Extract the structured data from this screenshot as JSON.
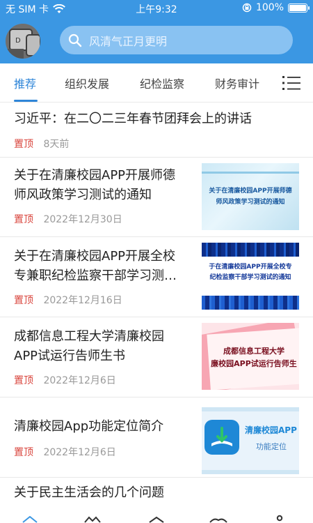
{
  "status": {
    "carrier": "无 SIM 卡",
    "time": "上午9:32",
    "battery": "100%"
  },
  "search": {
    "placeholder": "风清气正月更明"
  },
  "tabs": [
    {
      "label": "推荐",
      "active": true
    },
    {
      "label": "组织发展",
      "active": false
    },
    {
      "label": "纪检监察",
      "active": false
    },
    {
      "label": "财务审计",
      "active": false
    }
  ],
  "feed": [
    {
      "title": "习近平：在二〇二三年春节团拜会上的讲话",
      "pin": "置顶",
      "date": "8天前"
    },
    {
      "title_line1": "关于在清廉校园APP开展师德",
      "title_line2": "师风政策学习测试的通知",
      "pin": "置顶",
      "date": "2022年12月30日",
      "thumb_text_line1": "关于在清廉校园APP开展师德",
      "thumb_text_line2": "师风政策学习测试的通知"
    },
    {
      "title_line1": "关于在清廉校园APP开展全校",
      "title_line2": "专兼职纪检监察干部学习测…",
      "pin": "置顶",
      "date": "2022年12月16日",
      "thumb_text_line1": "于在清廉校园APP开展全校专",
      "thumb_text_line2": "纪检监察干部学习测试的通知"
    },
    {
      "title_line1": "成都信息工程大学清廉校园",
      "title_line2": "APP试运行告师生书",
      "pin": "置顶",
      "date": "2022年12月6日",
      "thumb_text_line1": "成都信息工程大学",
      "thumb_text_line2": "廉校园APP试运行告师生"
    },
    {
      "title": "清廉校园App功能定位简介",
      "pin": "置顶",
      "date": "2022年12月6日",
      "thumb_text_line1": "清廉校园APP",
      "thumb_text_line2": "功能定位"
    },
    {
      "title": "关于民主生活会的几个问题"
    }
  ],
  "colors": {
    "brand": "#3b97e3",
    "pin": "#d9453d"
  }
}
